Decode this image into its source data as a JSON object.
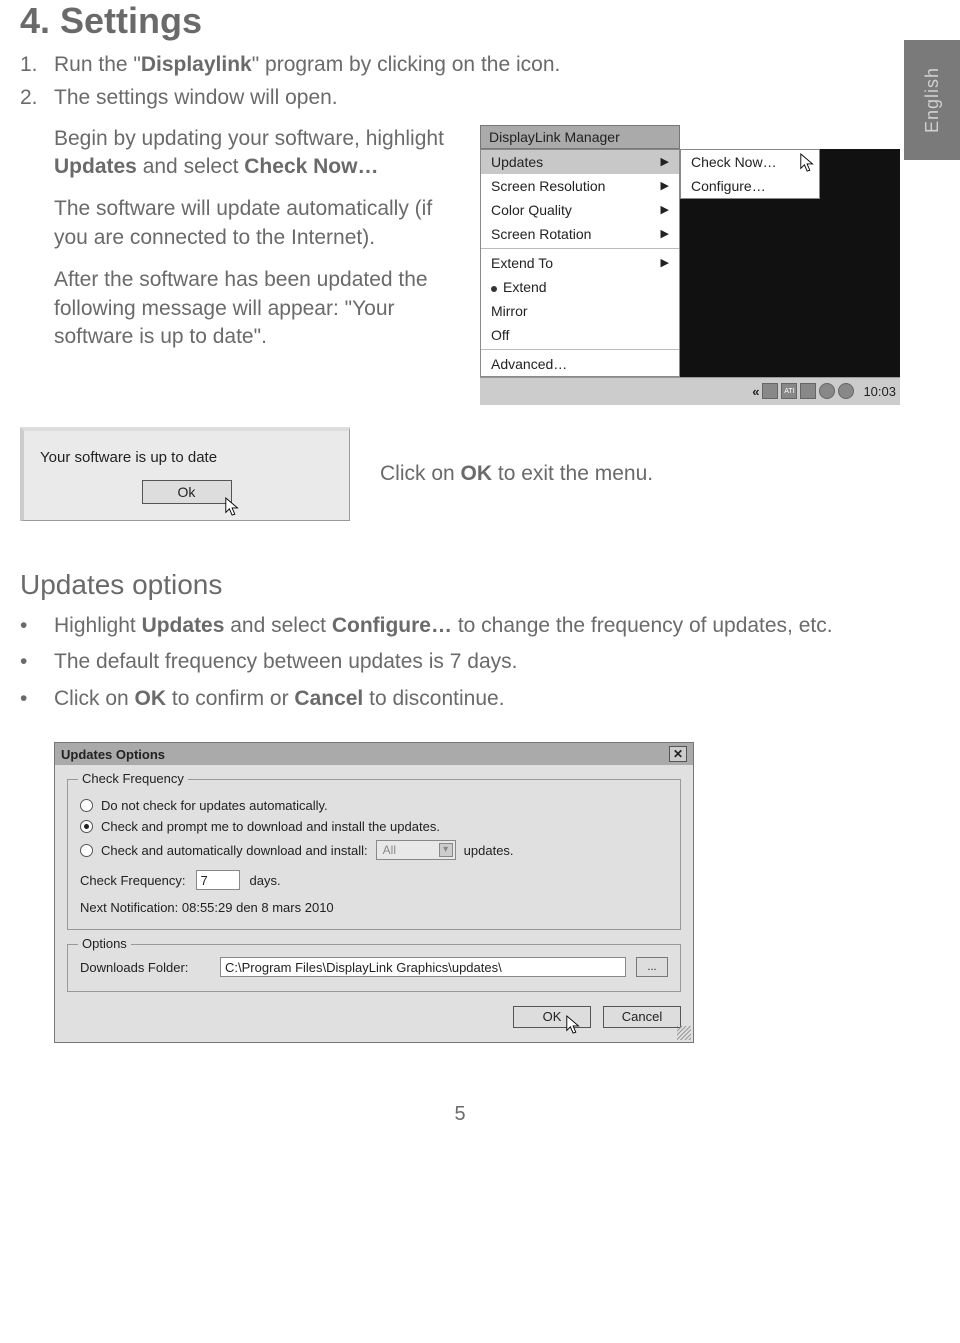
{
  "lang_tab": "English",
  "section_title": "4. Settings",
  "steps": [
    {
      "num": "1.",
      "text_pre": "Run the \"",
      "bold": "Displaylink",
      "text_post": "\" program by clicking on the icon."
    },
    {
      "num": "2.",
      "text_pre": "The settings window will open.",
      "bold": "",
      "text_post": ""
    }
  ],
  "para1_pre": "Begin by updating your software, highlight ",
  "para1_b1": "Updates",
  "para1_mid": " and select ",
  "para1_b2": "Check Now…",
  "para2": "The software will update automatically (if you are connected to the Internet).",
  "para3": "After the software has been updated the following message will appear: \"Your software is up to date\".",
  "dlm": {
    "title": "DisplayLink Manager",
    "items": [
      {
        "label": "Updates",
        "arrow": true,
        "sel": true
      },
      {
        "label": "Screen Resolution",
        "arrow": true
      },
      {
        "label": "Color Quality",
        "arrow": true
      },
      {
        "label": "Screen Rotation",
        "arrow": true
      },
      {
        "sep": true
      },
      {
        "label": "Extend To",
        "arrow": true
      },
      {
        "label": "Extend",
        "dot": true
      },
      {
        "label": "Mirror"
      },
      {
        "label": "Off"
      },
      {
        "sep": true
      },
      {
        "label": "Advanced…"
      }
    ],
    "submenu": [
      "Check Now…",
      "Configure…"
    ],
    "tray_chevron": "«",
    "tray_ati": "ATI",
    "clock": "10:03"
  },
  "ok_dialog": {
    "msg": "Your software is up to date",
    "btn": "Ok"
  },
  "ok_note_pre": "Click on ",
  "ok_note_bold": "OK",
  "ok_note_post": " to exit the menu.",
  "updates_heading": "Updates options",
  "updates_bullets": [
    {
      "pre": "Highlight ",
      "b1": "Updates",
      "mid": " and select ",
      "b2": "Configure…",
      "post": " to change the frequency of updates, etc."
    },
    {
      "pre": "The default frequency between updates is 7 days.",
      "b1": "",
      "mid": "",
      "b2": "",
      "post": ""
    },
    {
      "pre": "Click on ",
      "b1": "OK",
      "mid": " to confirm or ",
      "b2": "Cancel",
      "post": " to discontinue."
    }
  ],
  "updates_dialog": {
    "title": "Updates Options",
    "fs1_legend": "Check Frequency",
    "r1": "Do not check for updates automatically.",
    "r2": "Check and prompt me to download and install the updates.",
    "r3_pre": "Check and automatically download and install:",
    "r3_combo": "All",
    "r3_post": "updates.",
    "freq_label": "Check Frequency:",
    "freq_val": "7",
    "freq_unit": "days.",
    "next": "Next Notification: 08:55:29 den 8 mars 2010",
    "fs2_legend": "Options",
    "dl_label": "Downloads Folder:",
    "dl_path": "C:\\Program Files\\DisplayLink Graphics\\updates\\",
    "browse": "...",
    "ok": "OK",
    "cancel": "Cancel"
  },
  "page_num": "5"
}
